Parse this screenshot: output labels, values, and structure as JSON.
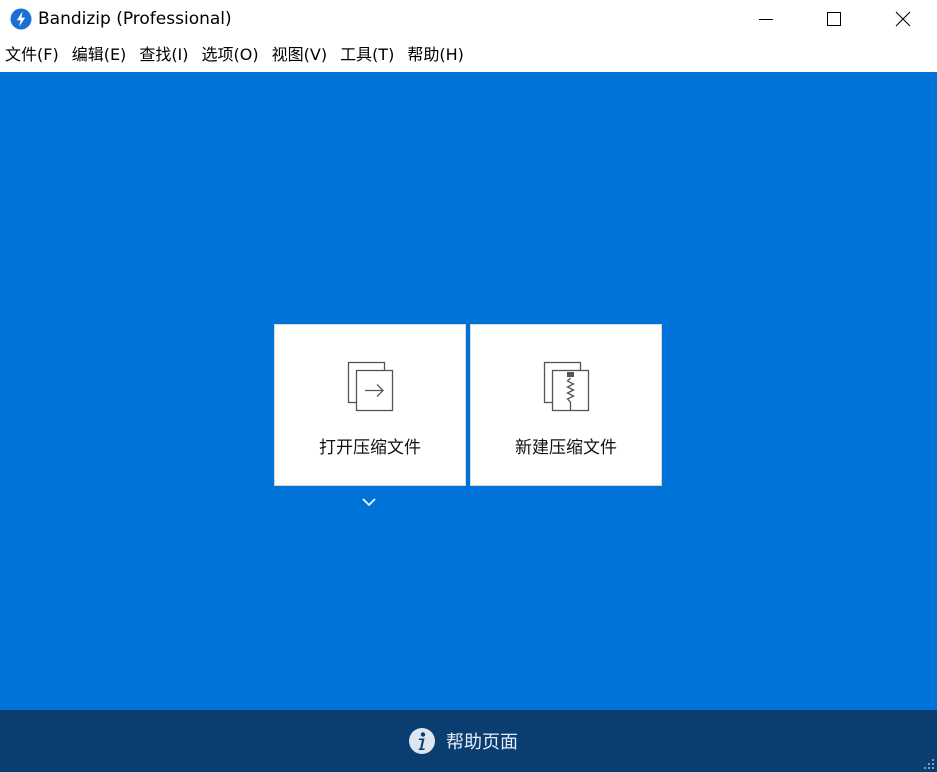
{
  "window": {
    "title": "Bandizip (Professional)",
    "app_icon": "bandizip-logo-icon",
    "controls": {
      "minimize_icon": "minimize-icon",
      "maximize_icon": "maximize-icon",
      "close_icon": "close-icon"
    }
  },
  "menu": {
    "items": [
      {
        "label": "文件(F)"
      },
      {
        "label": "编辑(E)"
      },
      {
        "label": "查找(I)"
      },
      {
        "label": "选项(O)"
      },
      {
        "label": "视图(V)"
      },
      {
        "label": "工具(T)"
      },
      {
        "label": "帮助(H)"
      }
    ]
  },
  "main": {
    "open_archive": {
      "label": "打开压缩文件",
      "icon": "open-archive-icon"
    },
    "new_archive": {
      "label": "新建压缩文件",
      "icon": "new-archive-icon"
    },
    "open_dropdown_icon": "chevron-down-icon"
  },
  "footer": {
    "help_label": "帮助页面",
    "help_icon": "info-icon"
  },
  "colors": {
    "main_background": "#0073d8",
    "footer_background": "#0a3d70",
    "card_background": "#ffffff",
    "app_icon_blue": "#1a6fd1"
  }
}
